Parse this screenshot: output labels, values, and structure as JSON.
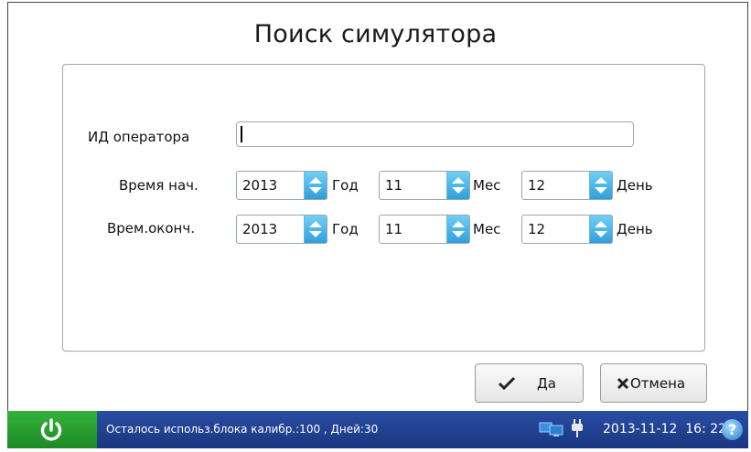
{
  "window": {
    "title": "Поиск симулятора"
  },
  "form": {
    "operator_label": "ИД оператора",
    "operator_value": "",
    "start_label": "Время нач.",
    "end_label": "Врем.оконч.",
    "start": {
      "year": "2013",
      "month": "11",
      "day": "12"
    },
    "end": {
      "year": "2013",
      "month": "11",
      "day": "12"
    },
    "units": {
      "year": "Год",
      "month": "Мес",
      "day": "День"
    }
  },
  "buttons": {
    "ok_label": "Да",
    "cancel_label": "Отмена"
  },
  "statusbar": {
    "message": "Осталось использ.блока калибр.:100 , Дней:30",
    "datetime": "2013-11-12  16: 22",
    "help_glyph": "?",
    "icons": [
      "power-icon",
      "network-icon",
      "plug-icon",
      "help-icon"
    ],
    "colors": {
      "bar": "#1f3f8f",
      "power": "#2aa033",
      "spin_accent": "#2f9fdc"
    }
  }
}
